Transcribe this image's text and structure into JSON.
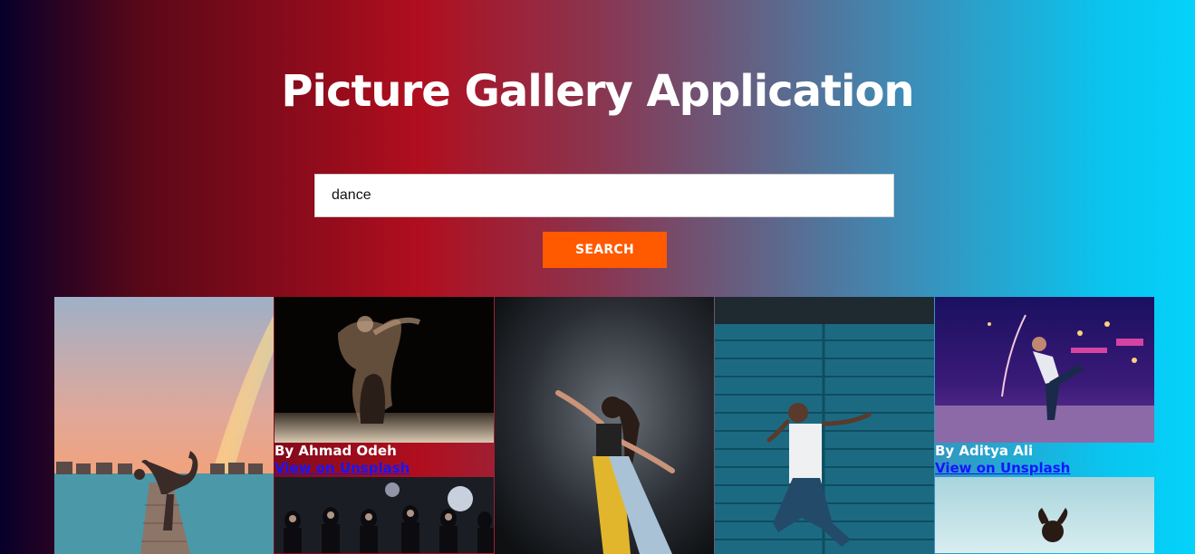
{
  "header": {
    "title": "Picture Gallery Application"
  },
  "search": {
    "value": "dance",
    "button_label": "SEARCH"
  },
  "colors": {
    "button": "#ff5a00",
    "link": "#1515ff"
  },
  "gallery": {
    "items": [
      {
        "author": "By Ahmad Odeh",
        "link": "View on Unsplash"
      },
      {
        "author": "By Aditya Ali",
        "link": "View on Unsplash"
      }
    ]
  }
}
